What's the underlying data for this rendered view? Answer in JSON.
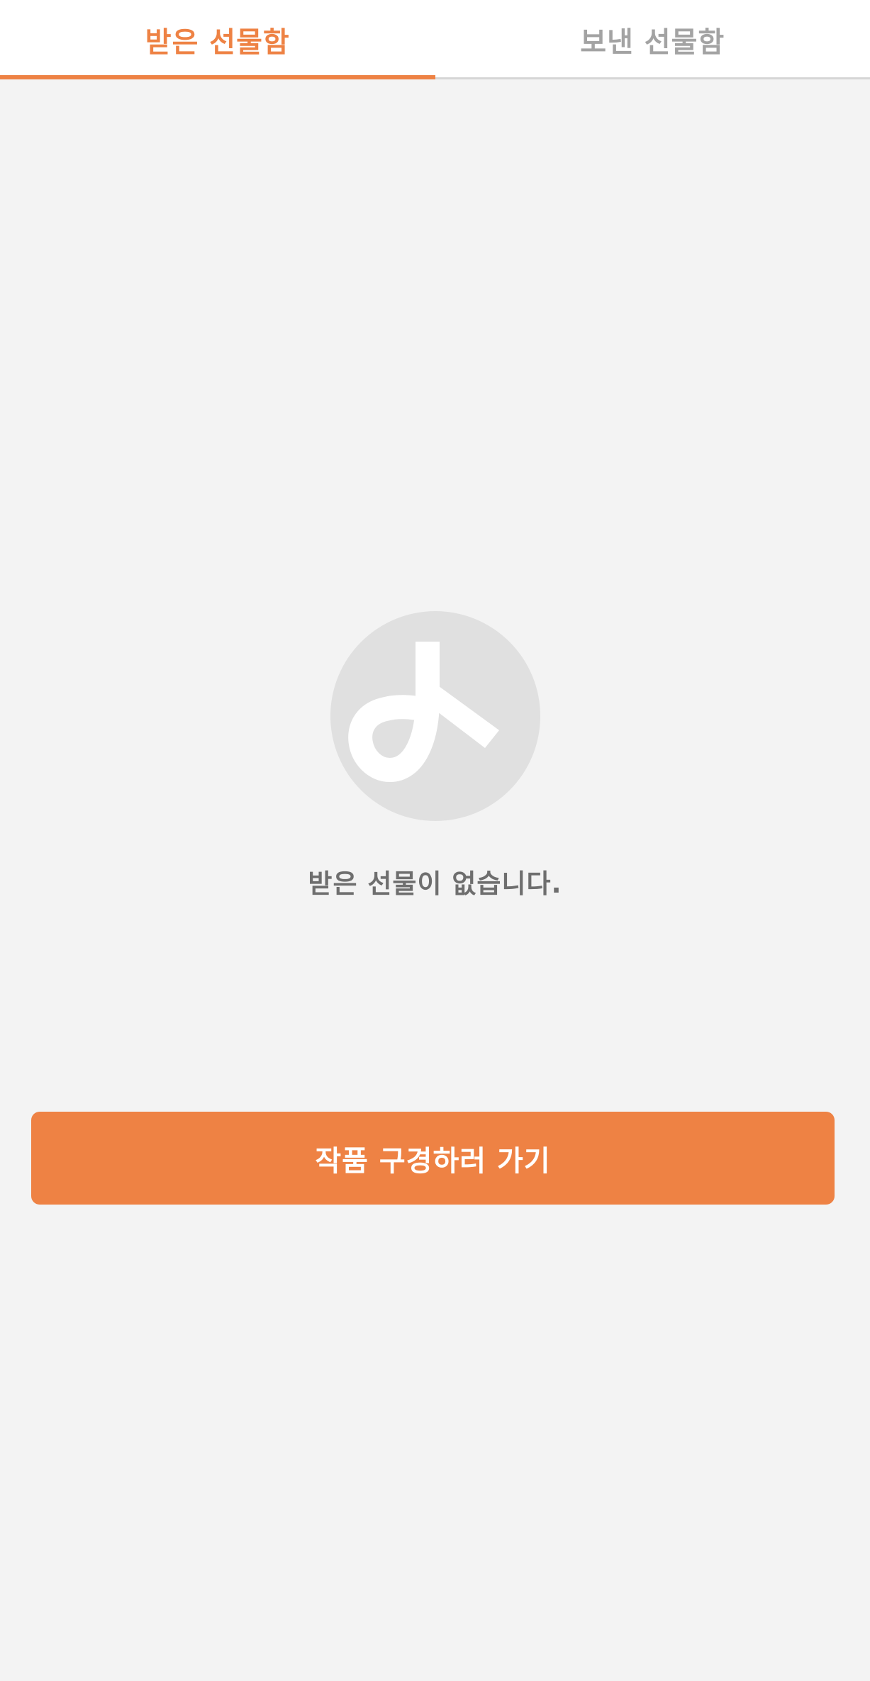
{
  "tabs": [
    {
      "label": "받은 선물함",
      "active": true
    },
    {
      "label": "보낸 선물함",
      "active": false
    }
  ],
  "empty_state": {
    "icon": "brand-logo-icon",
    "message": "받은 선물이 없습니다."
  },
  "cta": {
    "label": "작품 구경하러 가기"
  },
  "colors": {
    "accent": "#ee8244",
    "inactive_tab": "#a3a3a3",
    "background": "#f3f3f3",
    "logo_circle": "#e0e0e0",
    "message_text": "#6e6e6e"
  }
}
